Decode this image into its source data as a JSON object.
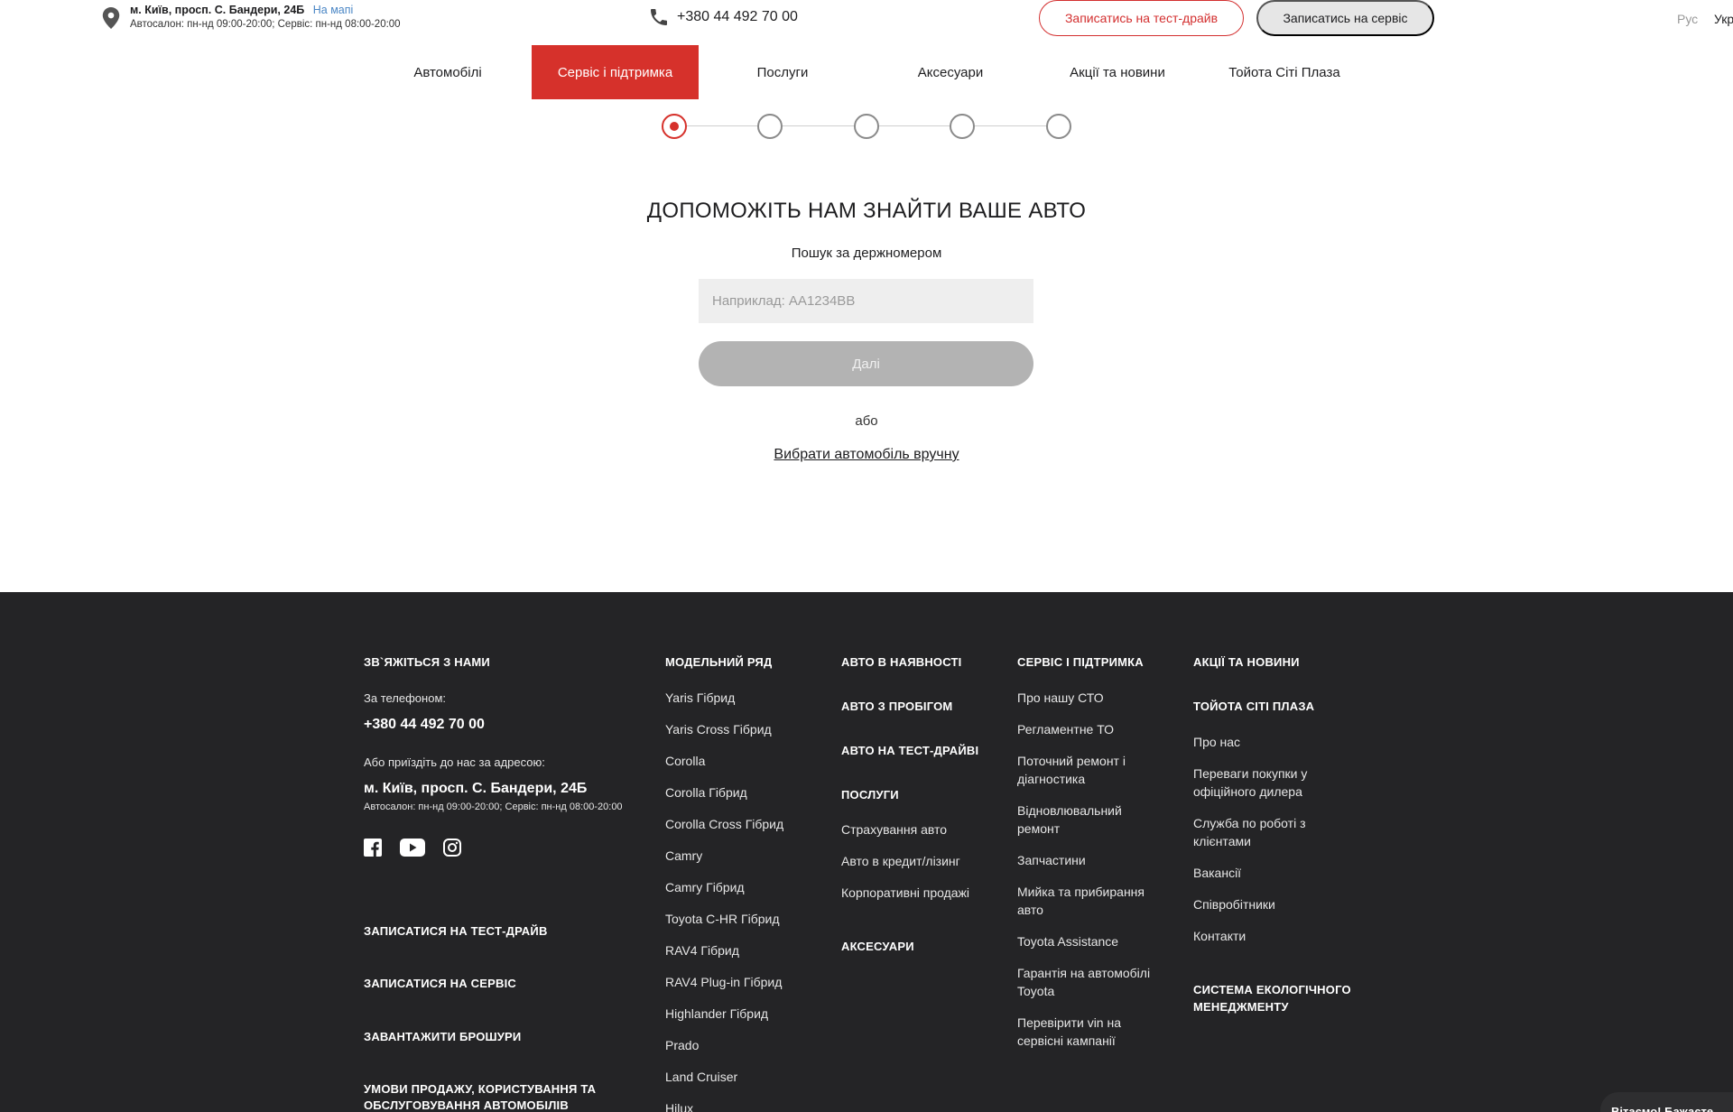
{
  "topbar": {
    "address": "м. Київ, просп. С. Бандери, 24Б",
    "map_link": "На мапі",
    "hours": "Автосалон: пн-нд 09:00-20:00; Сервіс: пн-нд 08:00-20:00",
    "phone": "+380 44 492 70 00",
    "testdrive_label": "Записатись на тест-драйв",
    "service_label": "Записатись на сервіс",
    "lang_ru": "Рус",
    "lang_ua": "Укр"
  },
  "nav": {
    "items": [
      {
        "label": "Автомобілі"
      },
      {
        "label": "Сервіс і підтримка"
      },
      {
        "label": "Послуги"
      },
      {
        "label": "Аксесуари"
      },
      {
        "label": "Акції та новини"
      },
      {
        "label": "Тойота Сіті Плаза"
      }
    ]
  },
  "stepper": {
    "steps_total": 5,
    "current_step": 1
  },
  "main": {
    "heading": "ДОПОМОЖІТЬ НАМ ЗНАЙТИ ВАШЕ АВТО",
    "subheading": "Пошук за держномером",
    "plate_placeholder": "Наприклад: АА1234ВВ",
    "plate_value": "",
    "next_label": "Далі",
    "or_text": "або",
    "manual_link": "Вибрати автомобіль вручну"
  },
  "footer": {
    "contact": {
      "title": "ЗВ`ЯЖІТЬСЯ З НАМИ",
      "phone_label": "За телефоном:",
      "phone": "+380 44 492 70 00",
      "address_label": "Або приїздіть до нас за адресою:",
      "address": "м. Київ, просп. С. Бандери, 24Б",
      "hours": "Автосалон: пн-нд 09:00-20:00; Сервіс: пн-нд 08:00-20:00",
      "links": [
        "ЗАПИСАТИСЯ НА ТЕСТ-ДРАЙВ",
        "ЗАПИСАТИСЯ НА СЕРВІС",
        "ЗАВАНТАЖИТИ БРОШУРИ",
        "УМОВИ ПРОДАЖУ, КОРИСТУВАННЯ ТА",
        "ОБСЛУГОВУВАННЯ АВТОМОБІЛІВ"
      ]
    },
    "models": {
      "title": "МОДЕЛЬНИЙ РЯД",
      "items": [
        "Yaris Гібрид",
        "Yaris Cross Гібрид",
        "Corolla",
        "Corolla Гібрид",
        "Corolla Cross Гібрид",
        "Camry",
        "Camry Гібрид",
        "Toyota C-HR Гібрид",
        "RAV4 Гібрид",
        "RAV4 Plug-in Гібрид",
        "Highlander Гібрид",
        "Prado",
        "Land Cruiser",
        "Hilux"
      ]
    },
    "stock": {
      "heads": [
        "АВТО В НАЯВНОСТІ",
        "АВТО З ПРОБІГОМ",
        "АВТО НА ТЕСТ-ДРАЙВІ",
        "ПОСЛУГИ"
      ],
      "services": [
        "Страхування авто",
        "Авто в кредит/лізинг",
        "Корпоративні продажі"
      ],
      "accessories": "АКСЕСУАРИ"
    },
    "service": {
      "title": "СЕРВІС І ПІДТРИМКА",
      "items": [
        "Про нашу СТО",
        "Регламентне ТО",
        "Поточний ремонт і",
        "діагностика",
        "Відновлювальний",
        "ремонт",
        "Запчастини",
        "Мийка та прибирання",
        "авто",
        "Toyota Assistance",
        "Гарантія на автомобілі",
        "Toyota",
        "Перевірити vin на",
        "сервісні кампанії"
      ]
    },
    "news": {
      "title": "АКЦІЇ ТА НОВИНИ",
      "plaza_title": "ТОЙОТА СІТІ ПЛАЗА",
      "items": [
        "Про нас",
        "Переваги покупки у",
        "офіційного дилера",
        "Служба по роботі з",
        "клієнтами",
        "Вакансії",
        "Співробітники",
        "Контакти"
      ],
      "eco_title_1": "СИСТЕМА ЕКОЛОГІЧНОГО",
      "eco_title_2": "МЕНЕДЖМЕНТУ"
    },
    "chat": "Вітаємо! Бажаєте"
  }
}
